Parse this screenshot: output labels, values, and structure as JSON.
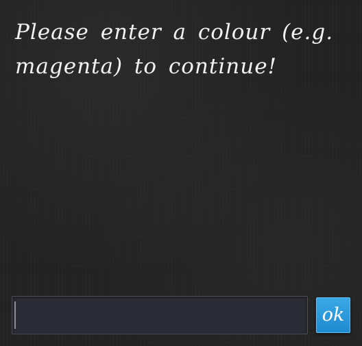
{
  "prompt": {
    "text": "Please enter a colour (e.g. magenta) to continue!"
  },
  "input": {
    "value": "",
    "placeholder": ""
  },
  "ok_button": {
    "label": "ok"
  },
  "colors": {
    "background": "#232323",
    "text": "#f2f2f2",
    "input_background": "#2b2b35",
    "input_border": "#4e4e5a",
    "button_accent": "#2b9ddd"
  }
}
